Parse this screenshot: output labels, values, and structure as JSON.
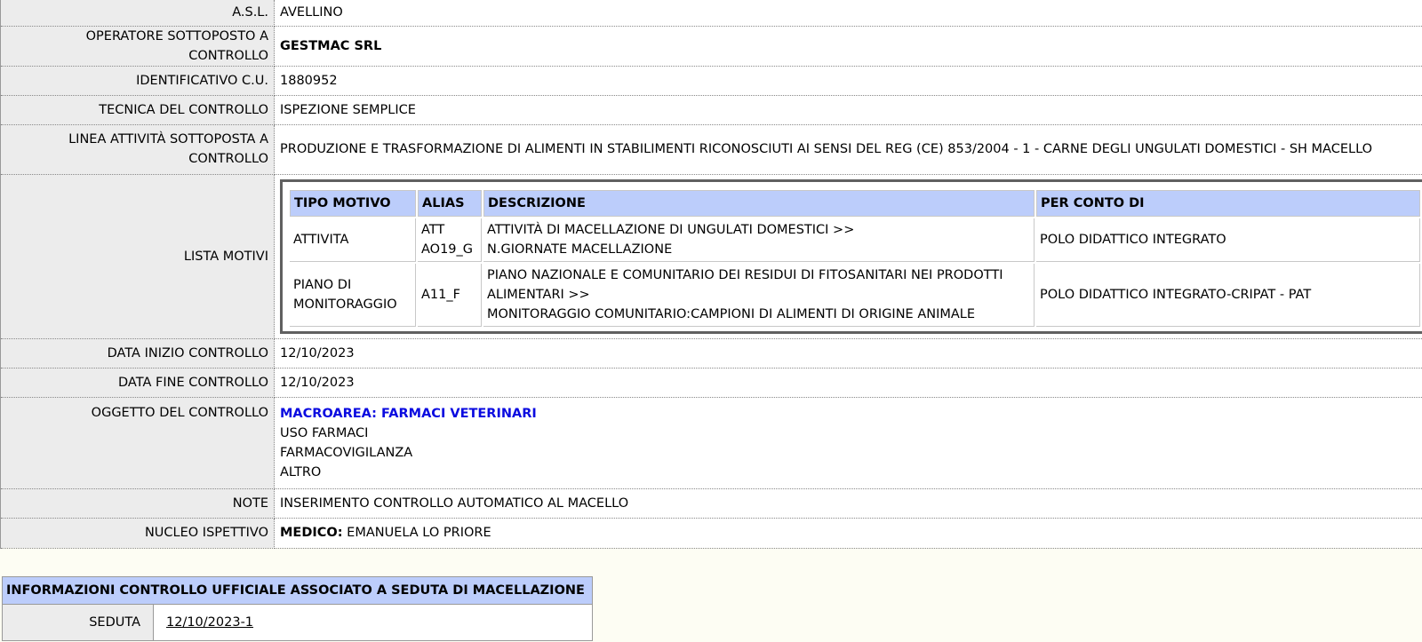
{
  "rows": {
    "asl": {
      "label": "A.S.L.",
      "value": "AVELLINO"
    },
    "operatore": {
      "label": "OPERATORE SOTTOPOSTO A CONTROLLO",
      "value": "GESTMAC SRL"
    },
    "identificativo": {
      "label": "IDENTIFICATIVO C.U.",
      "value": "1880952"
    },
    "tecnica": {
      "label": "TECNICA DEL CONTROLLO",
      "value": "ISPEZIONE SEMPLICE"
    },
    "linea": {
      "label_1": "LINEA ATTIVITÀ SOTTOPOSTA A",
      "label_2": "CONTROLLO",
      "value": "PRODUZIONE E TRASFORMAZIONE DI ALIMENTI IN STABILIMENTI RICONOSCIUTI AI SENSI DEL REG (CE) 853/2004 - 1 - CARNE DEGLI UNGULATI DOMESTICI - SH MACELLO"
    },
    "motivi": {
      "label": "LISTA MOTIVI"
    },
    "data_inizio": {
      "label": "DATA INIZIO CONTROLLO",
      "value": "12/10/2023"
    },
    "data_fine": {
      "label": "DATA FINE CONTROLLO",
      "value": "12/10/2023"
    },
    "oggetto": {
      "label": "OGGETTO DEL CONTROLLO",
      "macroarea": "MACROAREA: FARMACI VETERINARI",
      "items": [
        "USO FARMACI",
        "FARMACOVIGILANZA",
        "ALTRO"
      ]
    },
    "note": {
      "label": "NOTE",
      "value": "INSERIMENTO CONTROLLO AUTOMATICO AL MACELLO"
    },
    "nucleo": {
      "label": "NUCLEO ISPETTIVO",
      "role": "MEDICO:",
      "value": "EMANUELA LO PRIORE"
    }
  },
  "motivi_table": {
    "headers": [
      "TIPO MOTIVO",
      "ALIAS",
      "DESCRIZIONE",
      "PER CONTO DI"
    ],
    "rows": [
      {
        "tipo": [
          "ATTIVITA"
        ],
        "alias": [
          "ATT",
          "AO19_G"
        ],
        "descrizione": [
          "ATTIVITÀ DI MACELLAZIONE DI UNGULATI DOMESTICI >>",
          "N.GIORNATE MACELLAZIONE"
        ],
        "per_conto_di": "POLO DIDATTICO INTEGRATO"
      },
      {
        "tipo": [
          "PIANO DI",
          "MONITORAGGIO"
        ],
        "alias": [
          "A11_F"
        ],
        "descrizione": [
          "PIANO NAZIONALE E COMUNITARIO DEI RESIDUI DI FITOSANITARI NEI PRODOTTI",
          "ALIMENTARI >>",
          "MONITORAGGIO COMUNITARIO:CAMPIONI DI ALIMENTI DI ORIGINE ANIMALE"
        ],
        "per_conto_di": "POLO DIDATTICO INTEGRATO-CRIPAT - PAT"
      }
    ]
  },
  "seduta_section": {
    "title": "INFORMAZIONI CONTROLLO UFFICIALE ASSOCIATO A SEDUTA DI MACELLAZIONE",
    "label": "SEDUTA",
    "value": "12/10/2023-1"
  }
}
